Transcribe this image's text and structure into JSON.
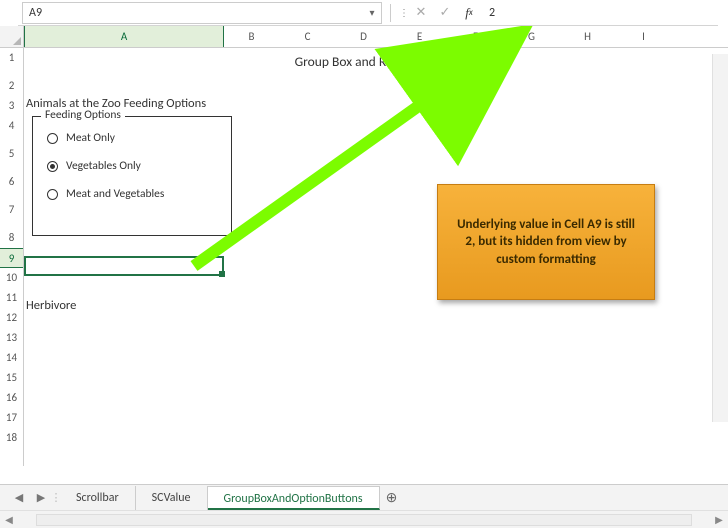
{
  "formula_bar": {
    "name_box": "A9",
    "formula_value": "2"
  },
  "columns": [
    "A",
    "B",
    "C",
    "D",
    "E",
    "F",
    "G",
    "H",
    "I"
  ],
  "rows": [
    "1",
    "2",
    "3",
    "4",
    "5",
    "6",
    "7",
    "8",
    "9",
    "10",
    "11",
    "12",
    "13",
    "14",
    "15",
    "16",
    "17",
    "18"
  ],
  "selected": {
    "cell": "A9",
    "row_index": 8,
    "col_index": 0
  },
  "content": {
    "title": "Group Box and Radio Buttons",
    "section_heading": "Animals at the Zoo Feeding Options",
    "group_box_label": "Feeding Options",
    "options": [
      {
        "label": "Meat Only",
        "checked": false
      },
      {
        "label": "Vegetables Only",
        "checked": true
      },
      {
        "label": "Meat and Vegetables",
        "checked": false
      }
    ],
    "a11_value": "Herbivore"
  },
  "callout": {
    "text": "Underlying value in Cell A9 is still 2, but its hidden from view by custom formatting"
  },
  "tabs": {
    "items": [
      {
        "label": "Scrollbar",
        "active": false
      },
      {
        "label": "SCValue",
        "active": false
      },
      {
        "label": "GroupBoxAndOptionButtons",
        "active": true
      }
    ]
  }
}
